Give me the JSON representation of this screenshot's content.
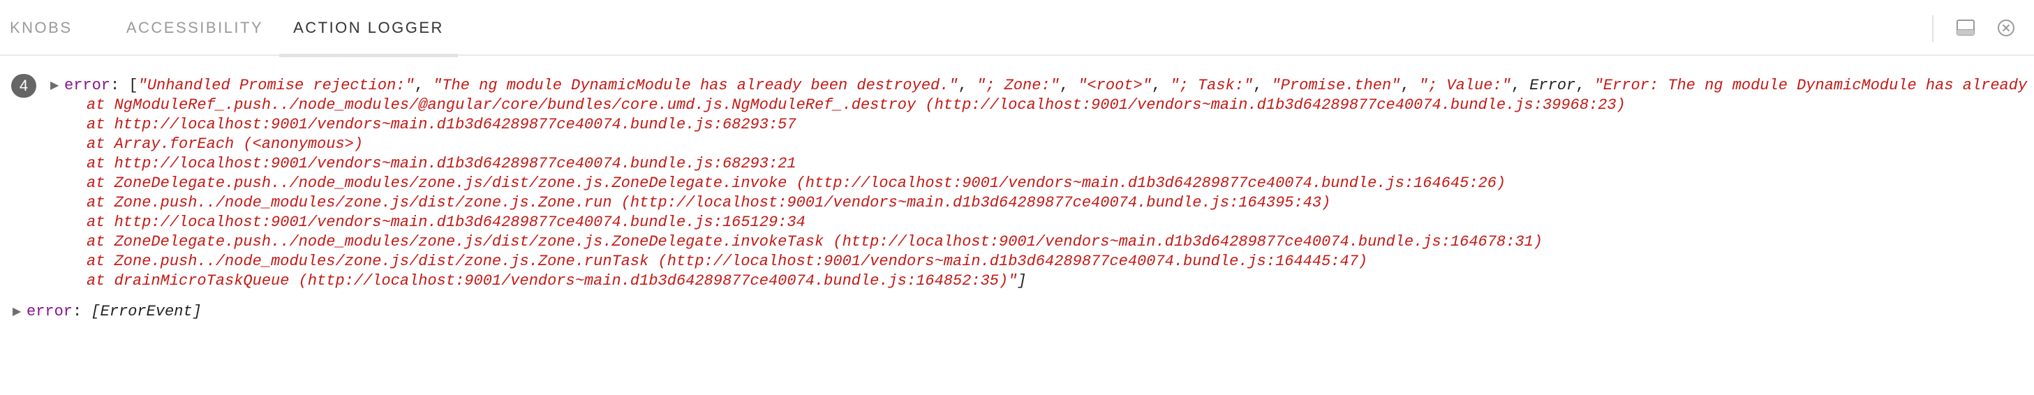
{
  "tabs": [
    {
      "label": "KNOBS",
      "active": false
    },
    {
      "label": "ACCESSIBILITY",
      "active": false
    },
    {
      "label": "ACTION LOGGER",
      "active": true
    }
  ],
  "toolbar": {
    "panel_icon": "panel-layout-icon",
    "clear_icon": "close-circle-icon"
  },
  "log": {
    "count_badge": "4",
    "entry1": {
      "key": "error",
      "sep": ": ",
      "open": "[",
      "strings": [
        "\"Unhandled Promise rejection:\"",
        "\"The ng module DynamicModule has already been destroyed.\"",
        "\"; Zone:\"",
        "\"<root>\"",
        "\"; Task:\"",
        "\"Promise.then\"",
        "\"; Value:\""
      ],
      "plain_value": "Error",
      "last_string_start": "\"Error: The ng module DynamicModule has already",
      "stack": [
        "at NgModuleRef_.push../node_modules/@angular/core/bundles/core.umd.js.NgModuleRef_.destroy (http://localhost:9001/vendors~main.d1b3d64289877ce40074.bundle.js:39968:23)",
        "at http://localhost:9001/vendors~main.d1b3d64289877ce40074.bundle.js:68293:57",
        "at Array.forEach (<anonymous>)",
        "at http://localhost:9001/vendors~main.d1b3d64289877ce40074.bundle.js:68293:21",
        "at ZoneDelegate.push../node_modules/zone.js/dist/zone.js.ZoneDelegate.invoke (http://localhost:9001/vendors~main.d1b3d64289877ce40074.bundle.js:164645:26)",
        "at Zone.push../node_modules/zone.js/dist/zone.js.Zone.run (http://localhost:9001/vendors~main.d1b3d64289877ce40074.bundle.js:164395:43)",
        "at http://localhost:9001/vendors~main.d1b3d64289877ce40074.bundle.js:165129:34",
        "at ZoneDelegate.push../node_modules/zone.js/dist/zone.js.ZoneDelegate.invokeTask (http://localhost:9001/vendors~main.d1b3d64289877ce40074.bundle.js:164678:31)",
        "at Zone.push../node_modules/zone.js/dist/zone.js.Zone.runTask (http://localhost:9001/vendors~main.d1b3d64289877ce40074.bundle.js:164445:47)",
        "at drainMicroTaskQueue (http://localhost:9001/vendors~main.d1b3d64289877ce40074.bundle.js:164852:35)\""
      ],
      "close": "]"
    },
    "entry2": {
      "key": "error",
      "sep": ": ",
      "value": "[ErrorEvent]"
    }
  },
  "colors": {
    "key_purple": "#881391",
    "string_red": "#c41a16",
    "badge_gray": "#666666",
    "tab_active": "#333333",
    "tab_inactive": "#9a9a9a"
  }
}
